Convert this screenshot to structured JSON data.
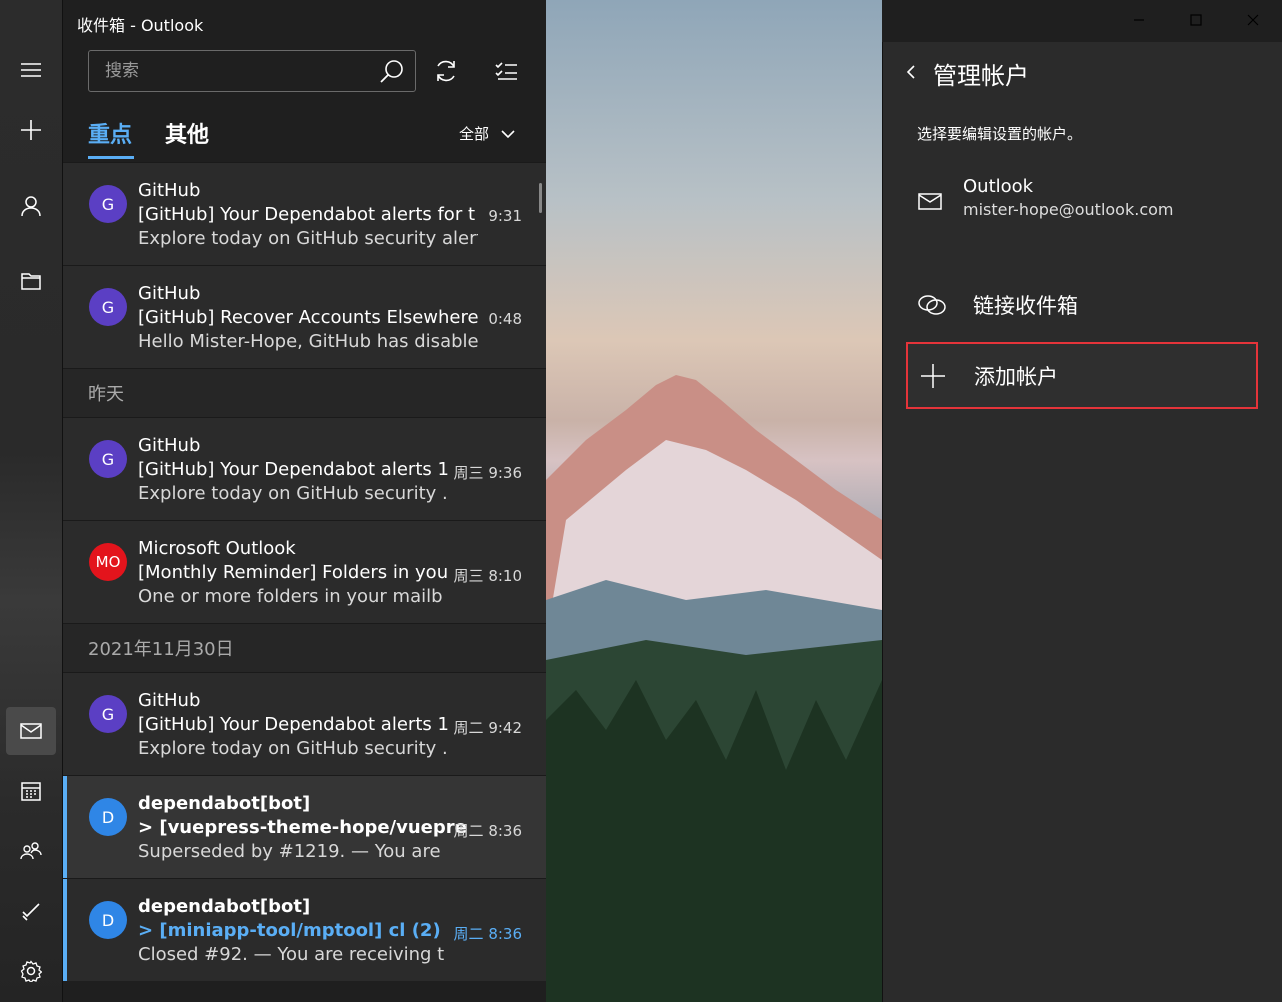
{
  "window": {
    "title": "收件箱 - Outlook"
  },
  "search": {
    "placeholder": "搜索"
  },
  "tabs": [
    {
      "label": "重点"
    },
    {
      "label": "其他"
    }
  ],
  "filter": {
    "label": "全部"
  },
  "messages_today": [
    {
      "avatar": "G",
      "avatar_color": "#5b3fc4",
      "sender": "GitHub",
      "subject": "[GitHub] Your Dependabot alerts for t",
      "preview": "Explore today on GitHub security alert",
      "time": "9:31"
    },
    {
      "avatar": "G",
      "avatar_color": "#5b3fc4",
      "sender": "GitHub",
      "subject": "[GitHub] Recover Accounts Elsewhere",
      "preview": "Hello Mister-Hope, GitHub has disable",
      "time": "0:48"
    }
  ],
  "group_yesterday": "昨天",
  "messages_yesterday": [
    {
      "avatar": "G",
      "avatar_color": "#5b3fc4",
      "sender": "GitHub",
      "subject": "[GitHub] Your Dependabot alerts 1",
      "preview": "Explore today on GitHub security .",
      "time": "周三 9:36"
    },
    {
      "avatar": "MO",
      "avatar_color": "#e3141c",
      "sender": "Microsoft Outlook",
      "subject": "[Monthly Reminder] Folders in you",
      "preview": "One or more folders in your mailb",
      "time": "周三 8:10"
    }
  ],
  "group_date": "2021年11月30日",
  "messages_older": [
    {
      "avatar": "G",
      "avatar_color": "#5b3fc4",
      "sender": "GitHub",
      "subject": "[GitHub] Your Dependabot alerts 1",
      "preview": "Explore today on GitHub security .",
      "time": "周二 9:42"
    },
    {
      "avatar": "D",
      "avatar_color": "#2f86e6",
      "sender": "dependabot[bot]",
      "subject": "> [vuepress-theme-hope/vuepre",
      "preview": "Superseded by #1219. — You are",
      "time": "周二 8:36"
    },
    {
      "avatar": "D",
      "avatar_color": "#2f86e6",
      "sender": "dependabot[bot]",
      "subject": "> [miniapp-tool/mptool] cl  (2)",
      "preview": "Closed #92. — You are receiving t",
      "time": "周二 8:36"
    }
  ],
  "panel": {
    "title": "管理帐户",
    "description": "选择要编辑设置的帐户。",
    "account": {
      "name": "Outlook",
      "email": "mister-hope@outlook.com"
    },
    "link_inboxes": "链接收件箱",
    "add_account": "添加帐户"
  },
  "colors": {
    "accent": "#5aaef5",
    "highlight_border": "#e5343a"
  }
}
